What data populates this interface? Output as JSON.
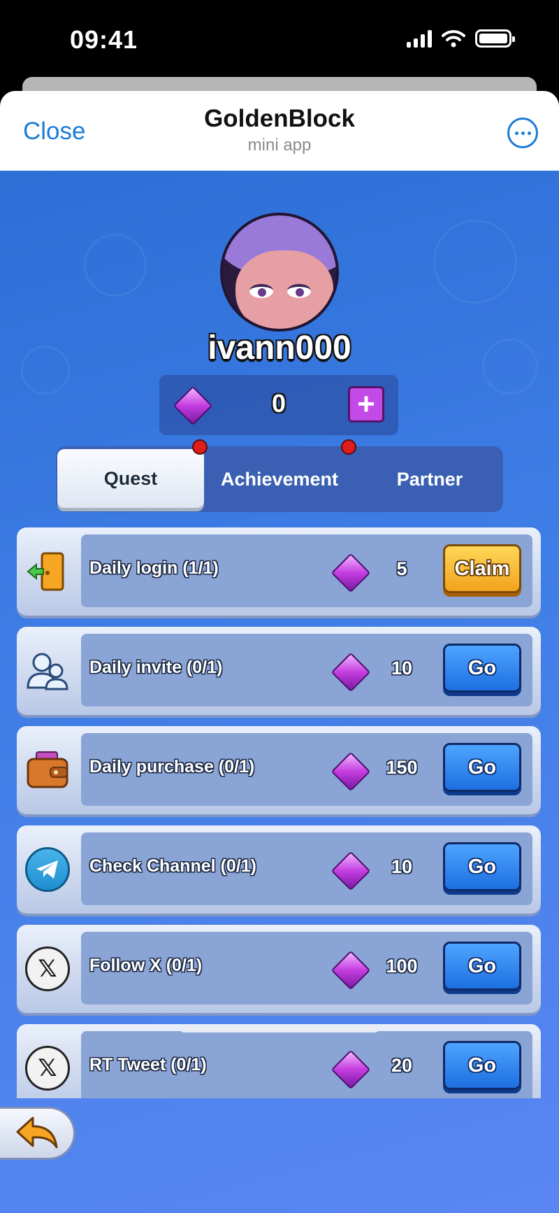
{
  "status_bar": {
    "time": "09:41"
  },
  "header": {
    "close_label": "Close",
    "title": "GoldenBlock",
    "subtitle": "mini app"
  },
  "profile": {
    "username": "ivann000",
    "balance": "0"
  },
  "tabs": [
    {
      "label": "Quest",
      "active": true,
      "notification": true
    },
    {
      "label": "Achievement",
      "active": false,
      "notification": true
    },
    {
      "label": "Partner",
      "active": false,
      "notification": false
    }
  ],
  "quests": [
    {
      "label": "Daily login (1/1)",
      "reward": "5",
      "button": "Claim",
      "icon": "door-exit-icon"
    },
    {
      "label": "Daily invite (0/1)",
      "reward": "10",
      "button": "Go",
      "icon": "users-icon"
    },
    {
      "label": "Daily purchase (0/1)",
      "reward": "150",
      "button": "Go",
      "icon": "wallet-icon"
    },
    {
      "label": "Check Channel (0/1)",
      "reward": "10",
      "button": "Go",
      "icon": "telegram-icon"
    },
    {
      "label": "Follow X (0/1)",
      "reward": "100",
      "button": "Go",
      "icon": "x-logo-icon"
    },
    {
      "label": "RT Tweet (0/1)",
      "reward": "20",
      "button": "Go",
      "icon": "x-logo-icon"
    }
  ],
  "colors": {
    "accent": "#1b7bd6",
    "background": "#3f7ee6",
    "go_button": "#1d6fe0",
    "claim_button": "#f2a21c",
    "gem": "#c43de0",
    "notification": "#e01d1d"
  }
}
